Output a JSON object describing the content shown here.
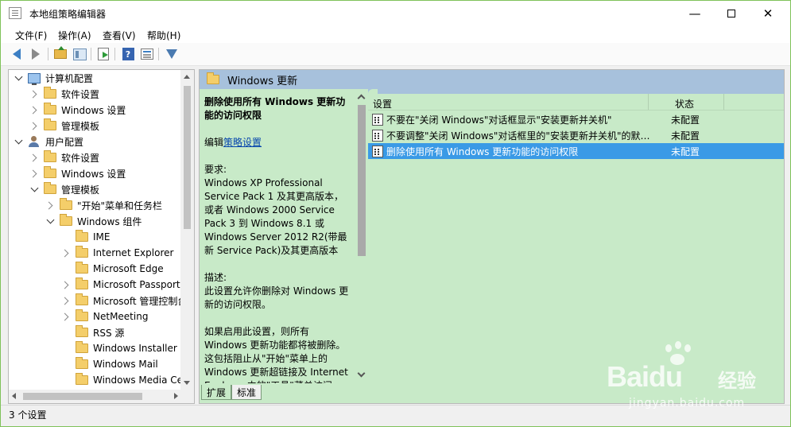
{
  "window": {
    "title": "本地组策略编辑器",
    "buttons": {
      "minimize": "—",
      "close": "✕"
    }
  },
  "menubar": {
    "items": [
      "文件(F)",
      "操作(A)",
      "查看(V)",
      "帮助(H)"
    ]
  },
  "toolbar": {
    "icons": [
      "back-arrow-icon",
      "forward-arrow-icon",
      "up-folder-icon",
      "show-tree-icon",
      "export-list-icon",
      "help-icon",
      "properties-icon",
      "filter-icon"
    ],
    "help_glyph": "?"
  },
  "tree": {
    "rows": [
      {
        "label": "计算机配置",
        "level": 0,
        "expand": "open",
        "icon": "computer-icon"
      },
      {
        "label": "软件设置",
        "level": 1,
        "expand": "closed",
        "icon": "folder-icon"
      },
      {
        "label": "Windows 设置",
        "level": 1,
        "expand": "closed",
        "icon": "folder-icon"
      },
      {
        "label": "管理模板",
        "level": 1,
        "expand": "closed",
        "icon": "folder-icon"
      },
      {
        "label": "用户配置",
        "level": 0,
        "expand": "open",
        "icon": "user-icon"
      },
      {
        "label": "软件设置",
        "level": 1,
        "expand": "closed",
        "icon": "folder-icon"
      },
      {
        "label": "Windows 设置",
        "level": 1,
        "expand": "closed",
        "icon": "folder-icon"
      },
      {
        "label": "管理模板",
        "level": 1,
        "expand": "open",
        "icon": "folder-icon"
      },
      {
        "label": "\"开始\"菜单和任务栏",
        "level": 2,
        "expand": "closed",
        "icon": "folder-icon"
      },
      {
        "label": "Windows 组件",
        "level": 2,
        "expand": "open",
        "icon": "folder-icon"
      },
      {
        "label": "IME",
        "level": 3,
        "expand": "none",
        "icon": "folder-icon"
      },
      {
        "label": "Internet Explorer",
        "level": 3,
        "expand": "closed",
        "icon": "folder-icon"
      },
      {
        "label": "Microsoft Edge",
        "level": 3,
        "expand": "none",
        "icon": "folder-icon"
      },
      {
        "label": "Microsoft Passport",
        "level": 3,
        "expand": "closed",
        "icon": "folder-icon"
      },
      {
        "label": "Microsoft 管理控制台",
        "level": 3,
        "expand": "closed",
        "icon": "folder-icon"
      },
      {
        "label": "NetMeeting",
        "level": 3,
        "expand": "closed",
        "icon": "folder-icon"
      },
      {
        "label": "RSS 源",
        "level": 3,
        "expand": "none",
        "icon": "folder-icon"
      },
      {
        "label": "Windows Installer",
        "level": 3,
        "expand": "none",
        "icon": "folder-icon"
      },
      {
        "label": "Windows Mail",
        "level": 3,
        "expand": "none",
        "icon": "folder-icon"
      },
      {
        "label": "Windows Media Center",
        "level": 3,
        "expand": "none",
        "icon": "folder-icon"
      }
    ]
  },
  "right": {
    "header_title": "Windows 更新",
    "description": {
      "title": "删除使用所有 Windows 更新功能的访问权限",
      "edit_prefix": "编辑",
      "edit_link": "策略设置",
      "req_label": "要求:",
      "req_text": "Windows XP Professional Service Pack 1 及其更高版本，或者 Windows 2000 Service Pack 3 到 Windows 8.1 或 Windows Server 2012 R2(带最新 Service Pack)及其更高版本",
      "desc_label": "描述:",
      "desc_text": "此设置允许你删除对 Windows 更新的访问权限。",
      "more_text": "如果启用此设置，则所有 Windows 更新功能都将被删除。这包括阻止从\"开始\"菜单上的 Windows 更新超链接及 Internet Explorer 中的\"工具\"菜单访问"
    },
    "columns": {
      "setting": "设置",
      "status": "状态"
    },
    "rows": [
      {
        "name": "不要在\"关闭 Windows\"对话框显示\"安装更新并关机\"",
        "status": "未配置",
        "selected": false
      },
      {
        "name": "不要调整\"关闭 Windows\"对话框里的\"安装更新并关机\"的默认选项",
        "status": "未配置",
        "selected": false
      },
      {
        "name": "删除使用所有 Windows 更新功能的访问权限",
        "status": "未配置",
        "selected": true
      }
    ],
    "tabs": [
      "扩展",
      "标准"
    ]
  },
  "statusbar": {
    "text": "3 个设置"
  },
  "watermark": {
    "brand": "Bai",
    "brand2": "du",
    "jingyan": "经验",
    "url": "jingyan.baidu.com"
  }
}
